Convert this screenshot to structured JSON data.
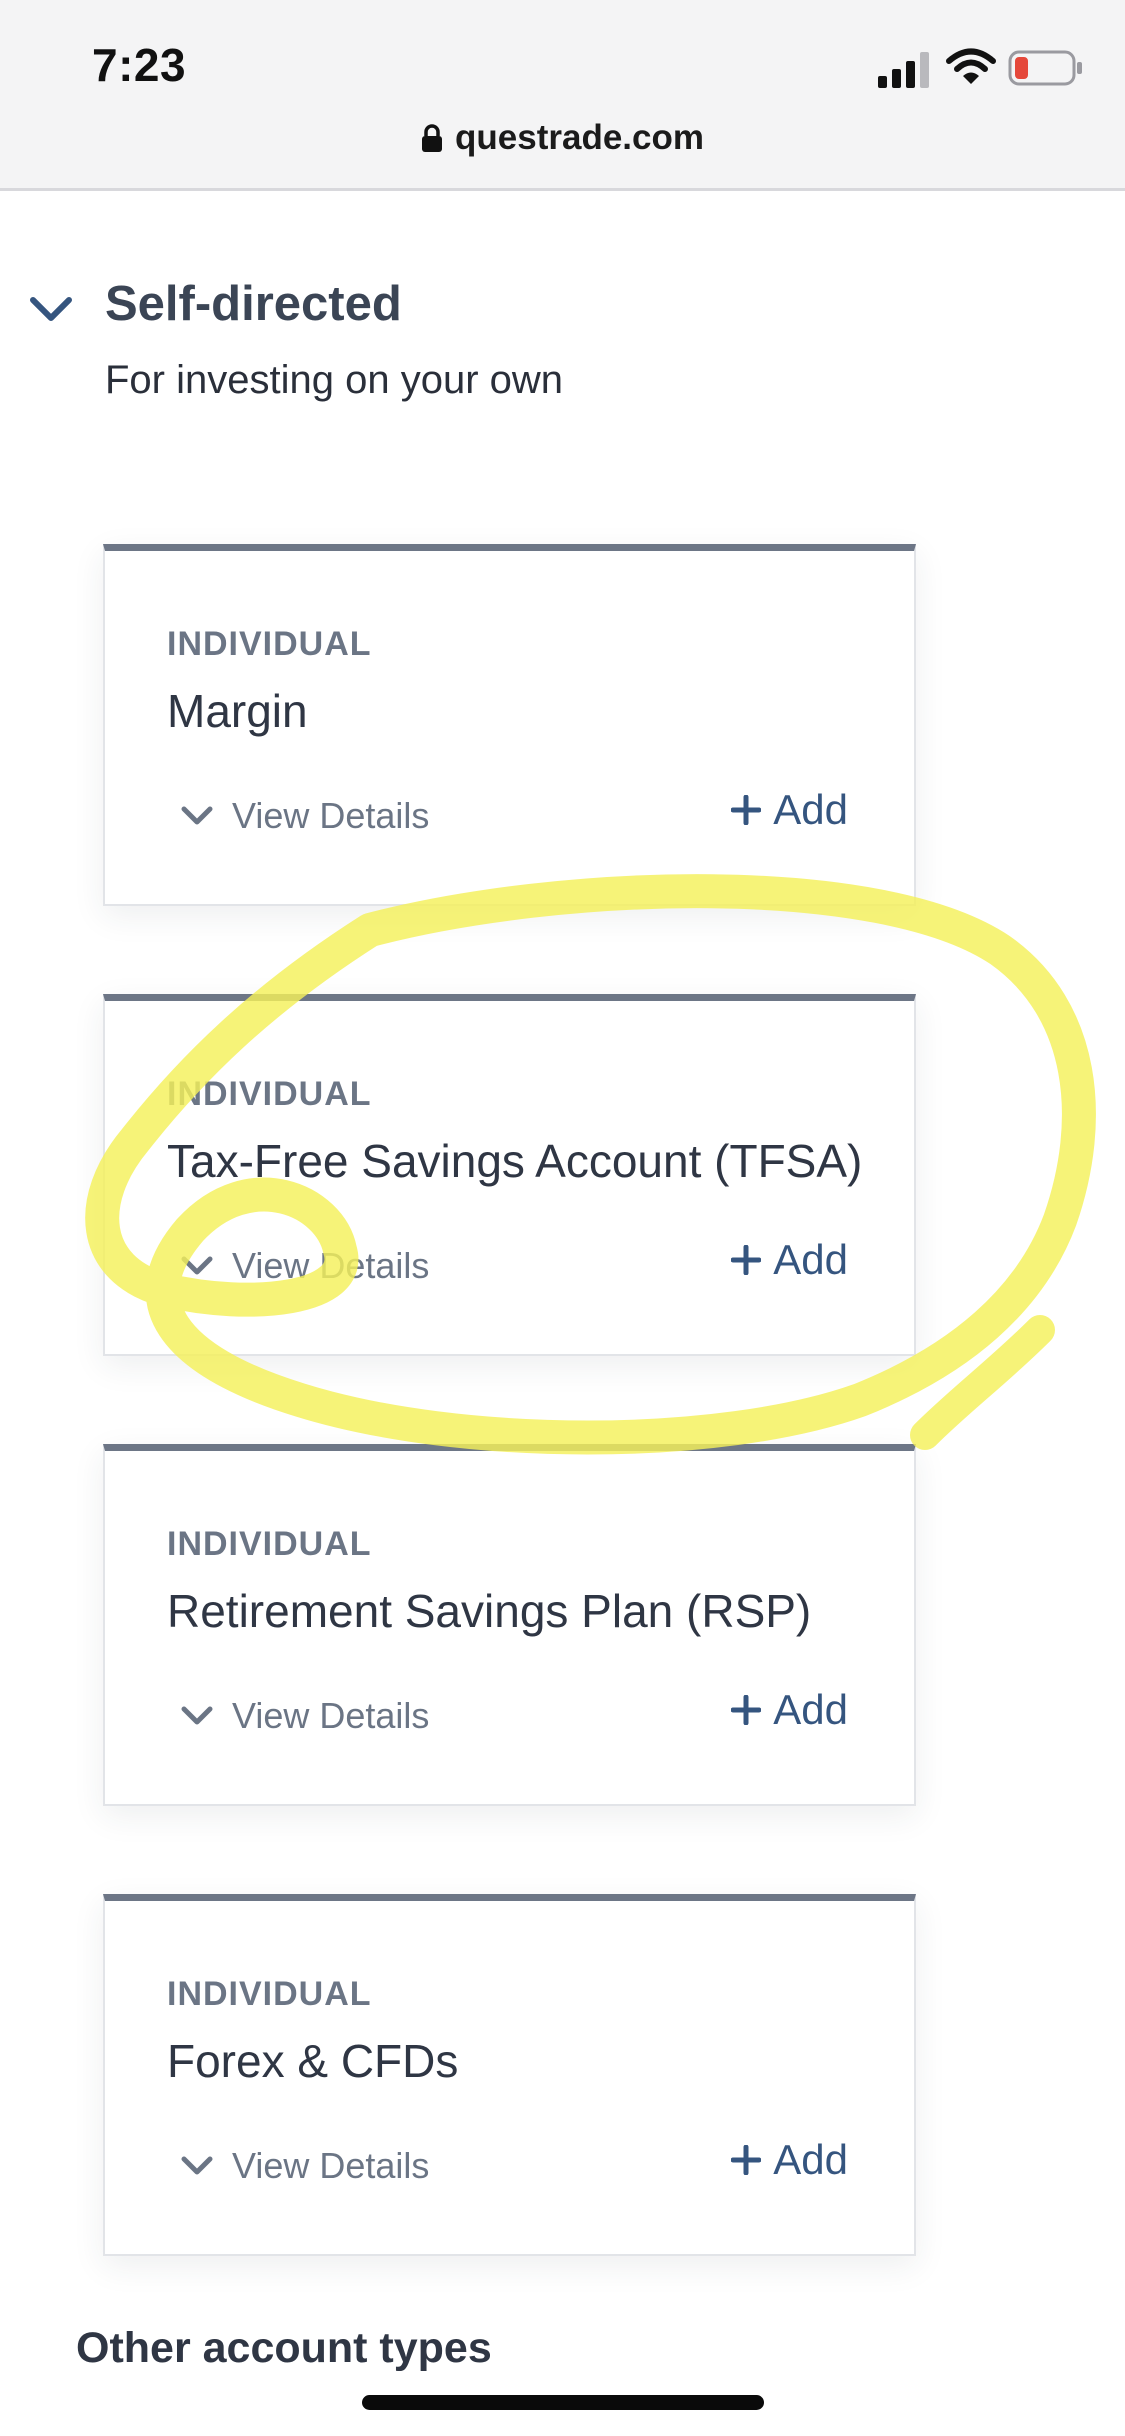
{
  "status_bar": {
    "time": "7:23",
    "icons": [
      "signal-icon",
      "wifi-icon",
      "battery-icon"
    ]
  },
  "address_bar": {
    "url": "questrade.com",
    "icon": "lock-icon"
  },
  "section": {
    "title": "Self-directed",
    "subtitle": "For investing on your own",
    "icon": "chevron-down-icon",
    "expanded": true
  },
  "accounts": [
    {
      "kicker": "INDIVIDUAL",
      "title": "Margin",
      "details_label": "View Details",
      "add_label": "Add"
    },
    {
      "kicker": "INDIVIDUAL",
      "title": "Tax-Free Savings Account (TFSA)",
      "details_label": "View Details",
      "add_label": "Add",
      "highlighted": true
    },
    {
      "kicker": "INDIVIDUAL",
      "title": "Retirement Savings Plan (RSP)",
      "details_label": "View Details",
      "add_label": "Add"
    },
    {
      "kicker": "INDIVIDUAL",
      "title": "Forex & CFDs",
      "details_label": "View Details",
      "add_label": "Add"
    }
  ],
  "other_heading": "Other account types",
  "colors": {
    "accent": "#35557f",
    "muted_text": "#6b7585",
    "card_top_border": "#6d7686",
    "highlighter": "#f4f05a",
    "battery_low": "#e5483b"
  }
}
